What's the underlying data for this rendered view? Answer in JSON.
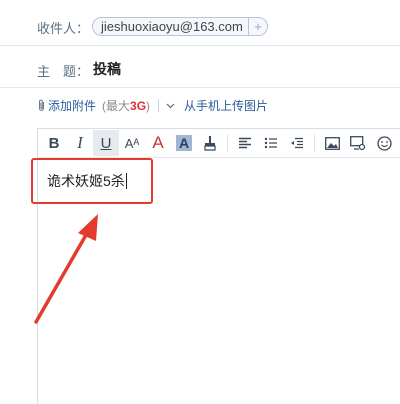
{
  "compose": {
    "to_label": "收件人：",
    "recipient": "jieshuoxiaoyu@163.com",
    "recipient_add": "+",
    "subject_label": "主　题：",
    "subject_value": "投稿",
    "attach_label": "添加附件",
    "attach_limit_prefix": "(最大",
    "attach_limit_value": "3G",
    "attach_limit_suffix": ")",
    "mobile_upload": "从手机上传图片"
  },
  "toolbar": {
    "bold": "B",
    "italic": "I",
    "underline": "U",
    "font_size": "Aᴬ",
    "font_color": "A",
    "bg_color": "A"
  },
  "editor": {
    "body_text": "诡术妖姬5杀"
  },
  "colors": {
    "highlight": "#e53a2e",
    "link": "#2b5d9a",
    "limit_red": "#dd3333"
  }
}
